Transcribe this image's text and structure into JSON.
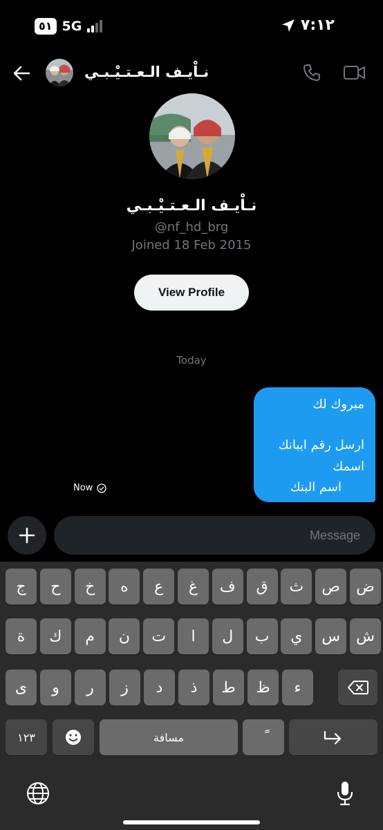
{
  "status_bar": {
    "sim": "٥١",
    "network": "5G",
    "time": "٧:١٢"
  },
  "header": {
    "name": "نـاْيـف الـعـتـيْـبـي"
  },
  "profile": {
    "name": "نـاْيـف الـعـتـيْـبـي",
    "handle": "@nf_hd_brg",
    "joined": "Joined 18 Feb 2015",
    "view_profile_label": "View Profile"
  },
  "conversation": {
    "day_label": "Today",
    "messages": [
      {
        "lines": [
          "مبروك لك",
          "",
          "ارسل رقم ايبانك",
          "اسمك",
          "اسم البنك"
        ],
        "time": "Now",
        "colors": {
          "bubble": "#1d9bf0"
        }
      }
    ]
  },
  "composer": {
    "placeholder": "Message"
  },
  "keyboard": {
    "row1": [
      "ض",
      "ص",
      "ث",
      "ق",
      "ف",
      "غ",
      "ع",
      "ه",
      "خ",
      "ح",
      "ج"
    ],
    "row2": [
      "ش",
      "س",
      "ي",
      "ب",
      "ل",
      "ا",
      "ت",
      "ن",
      "م",
      "ك",
      "ة"
    ],
    "row3": [
      "ء",
      "ظ",
      "ط",
      "ذ",
      "د",
      "ز",
      "ر",
      "و",
      "ى"
    ],
    "numbers_label": "١٢٣",
    "space_label": "مسافة",
    "tanween_label": "ً",
    "icons": [
      "backspace-icon",
      "emoji-icon",
      "return-icon",
      "globe-icon",
      "microphone-icon"
    ]
  }
}
